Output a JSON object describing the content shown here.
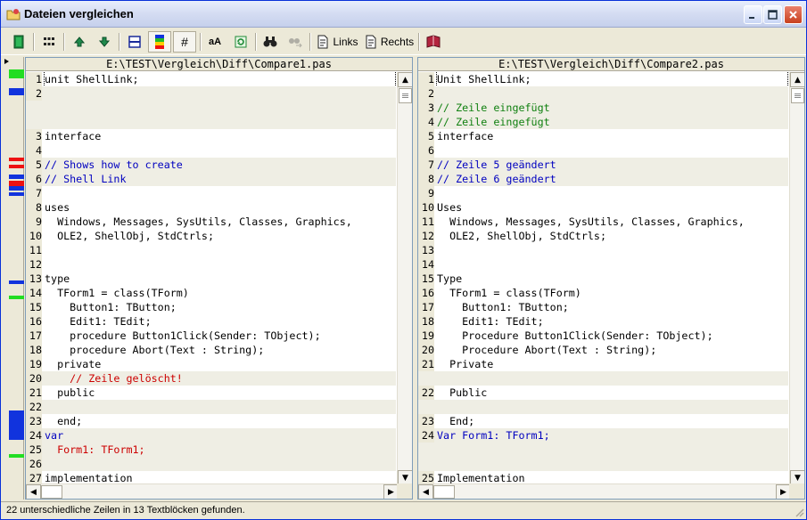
{
  "window": {
    "title": "Dateien vergleichen"
  },
  "toolbar": {
    "links_label": "Links",
    "rechts_label": "Rechts",
    "case_label": "aA",
    "hash_label": "#"
  },
  "left": {
    "file": "E:\\TEST\\Vergleich\\Diff\\Compare1.pas",
    "lines": [
      {
        "num": "1",
        "text": "unit ShellLink;",
        "kind": "",
        "color": ""
      },
      {
        "num": "2",
        "text": "",
        "kind": "changed",
        "color": ""
      },
      {
        "num": "",
        "text": "",
        "kind": "changed",
        "color": ""
      },
      {
        "num": "",
        "text": "",
        "kind": "changed",
        "color": ""
      },
      {
        "num": "3",
        "text": "interface",
        "kind": "",
        "color": ""
      },
      {
        "num": "4",
        "text": "",
        "kind": "",
        "color": ""
      },
      {
        "num": "5",
        "text": "// Shows how to create",
        "kind": "changed",
        "color": "blue"
      },
      {
        "num": "6",
        "text": "// Shell Link",
        "kind": "changed",
        "color": "blue"
      },
      {
        "num": "7",
        "text": "",
        "kind": "",
        "color": ""
      },
      {
        "num": "8",
        "text": "uses",
        "kind": "",
        "color": ""
      },
      {
        "num": "9",
        "text": "  Windows, Messages, SysUtils, Classes, Graphics,",
        "kind": "",
        "color": ""
      },
      {
        "num": "10",
        "text": "  OLE2, ShellObj, StdCtrls;",
        "kind": "",
        "color": ""
      },
      {
        "num": "11",
        "text": "",
        "kind": "",
        "color": ""
      },
      {
        "num": "12",
        "text": "",
        "kind": "",
        "color": ""
      },
      {
        "num": "13",
        "text": "type",
        "kind": "",
        "color": ""
      },
      {
        "num": "14",
        "text": "  TForm1 = class(TForm)",
        "kind": "",
        "color": ""
      },
      {
        "num": "15",
        "text": "    Button1: TButton;",
        "kind": "",
        "color": ""
      },
      {
        "num": "16",
        "text": "    Edit1: TEdit;",
        "kind": "",
        "color": ""
      },
      {
        "num": "17",
        "text": "    procedure Button1Click(Sender: TObject);",
        "kind": "",
        "color": ""
      },
      {
        "num": "18",
        "text": "    procedure Abort(Text : String);",
        "kind": "",
        "color": ""
      },
      {
        "num": "19",
        "text": "  private",
        "kind": "",
        "color": ""
      },
      {
        "num": "20",
        "text": "    // Zeile gelöscht!",
        "kind": "changed",
        "color": "red"
      },
      {
        "num": "21",
        "text": "  public",
        "kind": "",
        "color": ""
      },
      {
        "num": "22",
        "text": "",
        "kind": "changed",
        "color": ""
      },
      {
        "num": "23",
        "text": "  end;",
        "kind": "",
        "color": ""
      },
      {
        "num": "24",
        "text": "var",
        "kind": "changed",
        "color": "blue"
      },
      {
        "num": "25",
        "text": "  Form1: TForm1;",
        "kind": "changed",
        "color": "red"
      },
      {
        "num": "26",
        "text": "",
        "kind": "changed",
        "color": ""
      },
      {
        "num": "27",
        "text": "implementation",
        "kind": "",
        "color": ""
      }
    ]
  },
  "right": {
    "file": "E:\\TEST\\Vergleich\\Diff\\Compare2.pas",
    "lines": [
      {
        "num": "1",
        "text": "Unit ShellLink;",
        "kind": "",
        "color": ""
      },
      {
        "num": "2",
        "text": "",
        "kind": "changed",
        "color": ""
      },
      {
        "num": "3",
        "text": "// Zeile eingefügt",
        "kind": "changed",
        "color": "green"
      },
      {
        "num": "4",
        "text": "// Zeile eingefügt",
        "kind": "changed",
        "color": "green"
      },
      {
        "num": "5",
        "text": "interface",
        "kind": "",
        "color": ""
      },
      {
        "num": "6",
        "text": "",
        "kind": "",
        "color": ""
      },
      {
        "num": "7",
        "text": "// Zeile 5 geändert",
        "kind": "changed",
        "color": "blue"
      },
      {
        "num": "8",
        "text": "// Zeile 6 geändert",
        "kind": "changed",
        "color": "blue"
      },
      {
        "num": "9",
        "text": "",
        "kind": "",
        "color": ""
      },
      {
        "num": "10",
        "text": "Uses",
        "kind": "",
        "color": ""
      },
      {
        "num": "11",
        "text": "  Windows, Messages, SysUtils, Classes, Graphics,",
        "kind": "",
        "color": ""
      },
      {
        "num": "12",
        "text": "  OLE2, ShellObj, StdCtrls;",
        "kind": "",
        "color": ""
      },
      {
        "num": "13",
        "text": "",
        "kind": "",
        "color": ""
      },
      {
        "num": "14",
        "text": "",
        "kind": "",
        "color": ""
      },
      {
        "num": "15",
        "text": "Type",
        "kind": "",
        "color": ""
      },
      {
        "num": "16",
        "text": "  TForm1 = class(TForm)",
        "kind": "",
        "color": ""
      },
      {
        "num": "17",
        "text": "    Button1: TButton;",
        "kind": "",
        "color": ""
      },
      {
        "num": "18",
        "text": "    Edit1: TEdit;",
        "kind": "",
        "color": ""
      },
      {
        "num": "19",
        "text": "    Procedure Button1Click(Sender: TObject);",
        "kind": "",
        "color": ""
      },
      {
        "num": "20",
        "text": "    Procedure Abort(Text : String);",
        "kind": "",
        "color": ""
      },
      {
        "num": "21",
        "text": "  Private",
        "kind": "",
        "color": ""
      },
      {
        "num": "",
        "text": "",
        "kind": "changed",
        "color": ""
      },
      {
        "num": "22",
        "text": "  Public",
        "kind": "",
        "color": ""
      },
      {
        "num": "",
        "text": "",
        "kind": "changed",
        "color": ""
      },
      {
        "num": "23",
        "text": "  End;",
        "kind": "",
        "color": ""
      },
      {
        "num": "24",
        "text": "Var Form1: TForm1;",
        "kind": "changed",
        "color": "blue"
      },
      {
        "num": "",
        "text": "",
        "kind": "changed",
        "color": ""
      },
      {
        "num": "",
        "text": "",
        "kind": "changed",
        "color": ""
      },
      {
        "num": "25",
        "text": "Implementation",
        "kind": "",
        "color": ""
      }
    ]
  },
  "diff_markers": [
    {
      "color": "#22dd22",
      "kind": "inserted"
    },
    {
      "color": "#1133dd",
      "kind": "changed"
    },
    {
      "color": "#ee1111",
      "kind": "deleted"
    },
    {
      "color": "#ee1111",
      "kind": "deleted"
    },
    {
      "color": "#1133dd",
      "kind": "changed"
    },
    {
      "color": "#ee1111",
      "kind": "deleted"
    },
    {
      "color": "#1133dd",
      "kind": "changed"
    },
    {
      "color": "#1133dd",
      "kind": "changed"
    },
    {
      "color": "#1133dd",
      "kind": "changed"
    },
    {
      "color": "#22dd22",
      "kind": "inserted"
    },
    {
      "color": "#1133dd",
      "kind": "changed"
    },
    {
      "color": "#22dd22",
      "kind": "inserted"
    }
  ],
  "status": {
    "text": "22 unterschiedliche Zeilen in 13 Textblöcken gefunden."
  },
  "colors": {
    "blue": "#0000c0",
    "green": "#108010",
    "red": "#cc0000"
  }
}
